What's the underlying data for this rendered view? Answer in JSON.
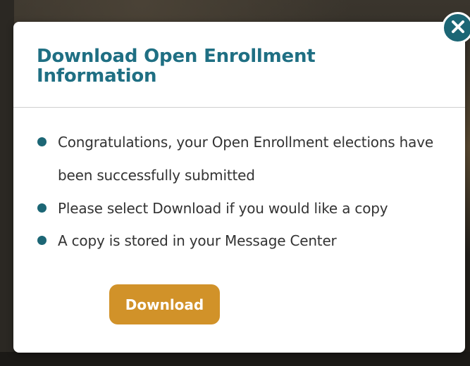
{
  "modal": {
    "title": "Download Open Enrollment Information",
    "bullets": [
      "Congratulations, your Open Enrollment elections have been successfully submitted",
      "Please select Download if you would like a copy",
      "A copy is stored in your Message Center"
    ],
    "download_label": "Download",
    "close_icon": "close-icon"
  },
  "colors": {
    "title": "#1f6f83",
    "bullet": "#1c6675",
    "button": "#d19229",
    "close": "#1c6675"
  }
}
